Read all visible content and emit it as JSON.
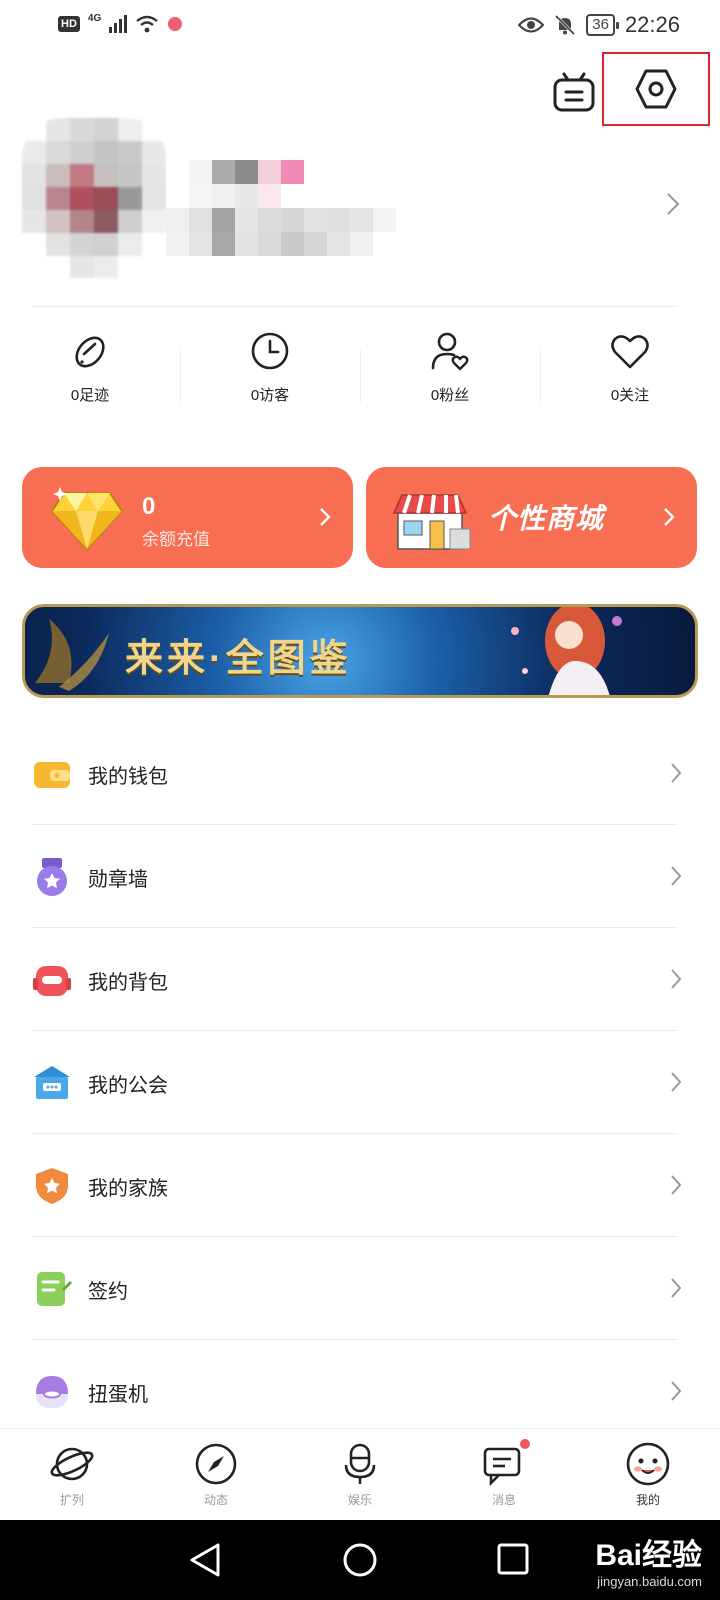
{
  "status_bar": {
    "hd": "HD",
    "network": "4G",
    "battery": "36",
    "time": "22:26"
  },
  "top_icons": [
    "robot-icon",
    "settings-icon"
  ],
  "stats": [
    {
      "label": "0足迹",
      "icon": "footprint-icon"
    },
    {
      "label": "0访客",
      "icon": "clock-icon"
    },
    {
      "label": "0粉丝",
      "icon": "fans-icon"
    },
    {
      "label": "0关注",
      "icon": "heart-icon"
    }
  ],
  "recharge": {
    "amount": "0",
    "label": "余额充值"
  },
  "mall": {
    "title": "个性商城"
  },
  "banner": {
    "title": "来来·全图鉴"
  },
  "menu": [
    {
      "label": "我的钱包",
      "icon": "wallet-icon",
      "color": "#f7b731"
    },
    {
      "label": "勋章墙",
      "icon": "medal-icon",
      "color": "#9b7be8"
    },
    {
      "label": "我的背包",
      "icon": "backpack-icon",
      "color": "#f0545a"
    },
    {
      "label": "我的公会",
      "icon": "guild-icon",
      "color": "#4aa8e8"
    },
    {
      "label": "我的家族",
      "icon": "family-shield-icon",
      "color": "#f08a3c"
    },
    {
      "label": "签约",
      "icon": "contract-icon",
      "color": "#8bd05a"
    },
    {
      "label": "扭蛋机",
      "icon": "gacha-icon",
      "color": "#a77be0"
    }
  ],
  "bottom_nav": [
    {
      "label": "扩列",
      "icon": "planet-icon",
      "active": false
    },
    {
      "label": "动态",
      "icon": "compass-icon",
      "active": false
    },
    {
      "label": "娱乐",
      "icon": "microphone-icon",
      "active": false
    },
    {
      "label": "消息",
      "icon": "message-icon",
      "active": false
    },
    {
      "label": "我的",
      "icon": "smiley-face-icon",
      "active": true
    }
  ],
  "watermark": {
    "main": "Bai经验",
    "sub": "jingyan.baidu.com"
  },
  "colors": {
    "accent": "#f86e53",
    "highlight_box": "#d9262b",
    "badge": "#f2575b"
  }
}
